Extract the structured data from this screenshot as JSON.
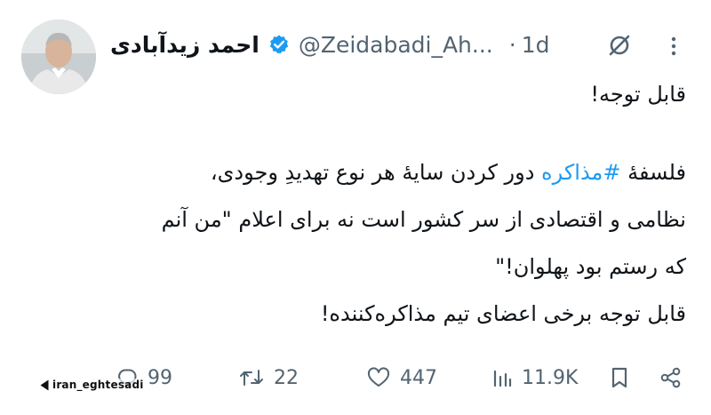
{
  "tweet": {
    "author": {
      "display_name": "احمد زیدآبادی",
      "handle": "@Zeidabadi_Ah...",
      "verified": true,
      "avatar_icon": "profile-photo"
    },
    "timestamp_sep": "·",
    "timestamp": "1d",
    "header_icons": [
      "verified-badge-icon",
      "mute-icon",
      "more-icon"
    ],
    "body_lines": {
      "line1": "قابل توجه!",
      "line2_before": "فلسفۀ ",
      "line2_hashtag": "#مذاکره",
      "line2_after": " دور کردن سایۀ هر نوع تهدیدِ وجودی،",
      "line3": "نظامی و اقتصادی از سر کشور است نه برای اعلام \"من آنم",
      "line4": "که رستم بود پهلوان!\"",
      "line5": "قابل توجه برخی اعضای تیم مذاکره‌کننده!"
    },
    "actions": {
      "replies": "99",
      "reposts": "22",
      "likes": "447",
      "views": "11.9K"
    },
    "action_icons": [
      "reply-icon",
      "repost-icon",
      "like-icon",
      "views-icon",
      "bookmark-icon",
      "share-icon"
    ],
    "colors": {
      "text": "#0f1419",
      "secondary": "#536471",
      "hashtag": "#1d9bf0",
      "verified": "#1d9bf0"
    }
  },
  "watermark": {
    "text": "iran_eghtesadi"
  }
}
